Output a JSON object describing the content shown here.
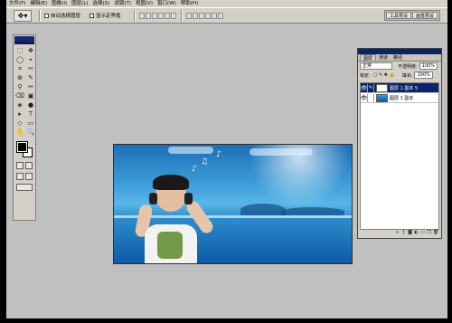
{
  "menubar": {
    "items": [
      "文件(F)",
      "编辑(E)",
      "图像(I)",
      "图层(L)",
      "选择(S)",
      "滤镜(T)",
      "视图(V)",
      "窗口(W)",
      "帮助(H)"
    ]
  },
  "options": {
    "tool_icon": "move-tool-icon",
    "auto_select_label": "自动选择图层",
    "show_bounds_label": "显示定界框",
    "well_tabs": [
      "工具预设",
      "画笔预设"
    ]
  },
  "toolbox": {
    "tools": [
      "⬚",
      "✥",
      "◯",
      "⌖",
      "⌗",
      "✂",
      "⊕",
      "✎",
      "⚲",
      "✏",
      "⌫",
      "▣",
      "◈",
      "●",
      "▸",
      "T",
      "◇",
      "▭",
      "✋",
      "🔍"
    ],
    "tool_names": [
      "marquee-tool-icon",
      "move-tool-icon",
      "lasso-tool-icon",
      "magic-wand-icon",
      "crop-tool-icon",
      "slice-tool-icon",
      "healing-brush-icon",
      "brush-tool-icon",
      "clone-stamp-icon",
      "history-brush-icon",
      "eraser-tool-icon",
      "gradient-tool-icon",
      "blur-tool-icon",
      "dodge-tool-icon",
      "path-select-icon",
      "type-tool-icon",
      "pen-tool-icon",
      "shape-tool-icon",
      "hand-tool-icon",
      "zoom-tool-icon"
    ],
    "foreground_color": "#000000",
    "background_color": "#ffffff"
  },
  "document": {
    "notes": [
      "♪",
      "♫",
      "♪"
    ]
  },
  "layers_panel": {
    "tabs": [
      "图层",
      "通道",
      "路径"
    ],
    "blend_mode": "正常",
    "opacity_label": "不透明度:",
    "opacity_value": "100%",
    "lock_label": "锁定:",
    "fill_label": "填充:",
    "fill_value": "100%",
    "layers": [
      {
        "name": "图层 1 副本 5",
        "visible": true,
        "selected": true
      },
      {
        "name": "图层 1 副本",
        "visible": true,
        "selected": false
      }
    ],
    "footer_icons": [
      "link-icon",
      "fx-icon",
      "mask-icon",
      "adjustment-icon",
      "folder-icon",
      "new-layer-icon",
      "trash-icon"
    ]
  }
}
